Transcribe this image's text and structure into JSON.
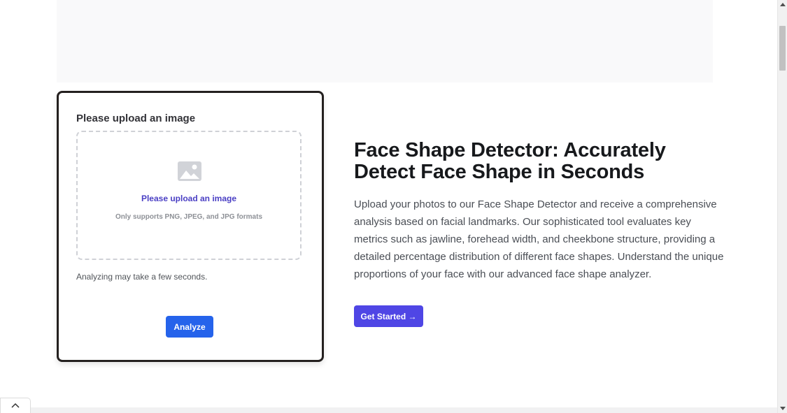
{
  "upload_card": {
    "title": "Please upload an image",
    "dropzone": {
      "icon": "image-icon",
      "primary_text": "Please upload an image",
      "secondary_text": "Only supports PNG, JPEG, and JPG formats"
    },
    "note": "Analyzing may take a few seconds.",
    "analyze_label": "Analyze"
  },
  "hero": {
    "heading": "Face Shape Detector: Accurately Detect Face Shape in Seconds",
    "description": "Upload your photos to our Face Shape Detector and receive a comprehensive analysis based on facial landmarks. Our sophisticated tool evaluates key metrics such as jawline, forehead width, and cheekbone structure, providing a detailed percentage distribution of different face shapes. Understand the unique proportions of your face with our advanced face shape analyzer.",
    "cta_label": "Get Started →"
  },
  "scroll_top": {
    "icon": "chevron-up-icon"
  },
  "colors": {
    "primary_blue": "#2563eb",
    "indigo": "#4f46e5",
    "link_purple": "#4a3fc4",
    "card_border": "#24201f"
  }
}
